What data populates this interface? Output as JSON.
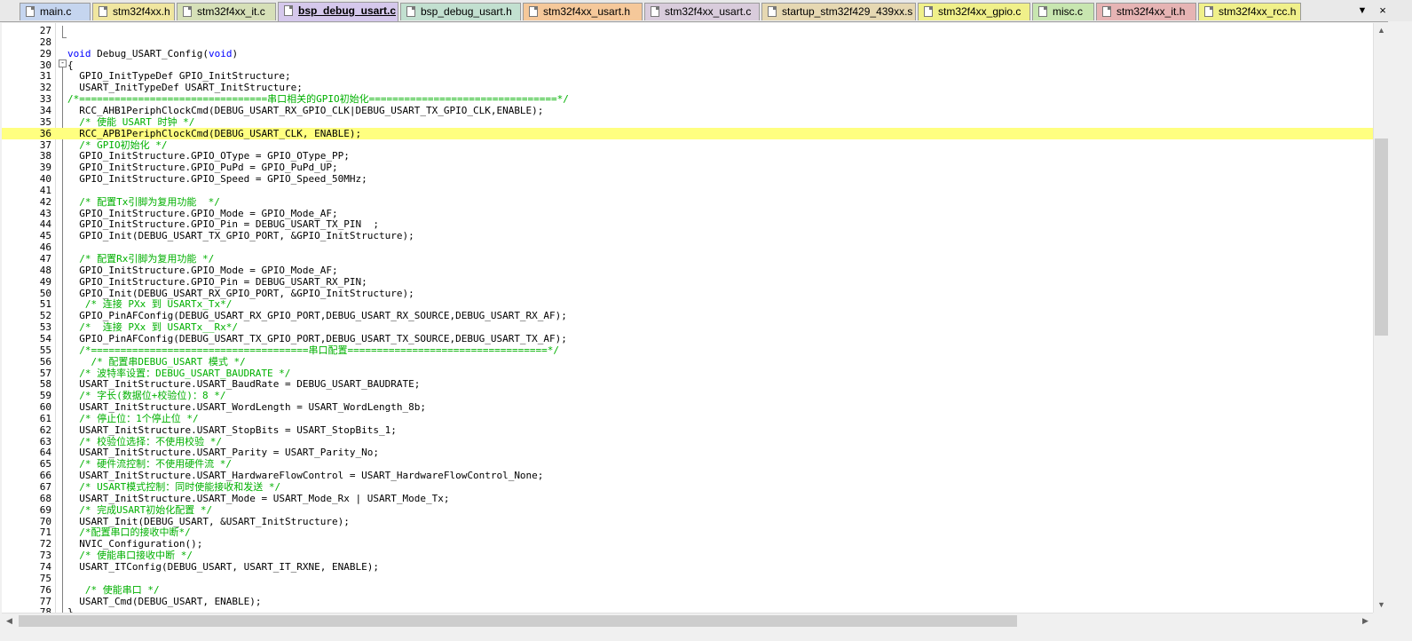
{
  "tabs": [
    {
      "label": "main.c",
      "color": "#c5d5ef",
      "active": false
    },
    {
      "label": "stm32f4xx.h",
      "color": "#f0e6a0",
      "active": false
    },
    {
      "label": "stm32f4xx_it.c",
      "color": "#d6e0b8",
      "active": false
    },
    {
      "label": "bsp_debug_usart.c",
      "color": "#d5c8ec",
      "active": true
    },
    {
      "label": "bsp_debug_usart.h",
      "color": "#c2e0d0",
      "active": false
    },
    {
      "label": "stm32f4xx_usart.h",
      "color": "#f5c89a",
      "active": false
    },
    {
      "label": "stm32f4xx_usart.c",
      "color": "#d9ccdc",
      "active": false
    },
    {
      "label": "startup_stm32f429_439xx.s",
      "color": "#e6d8b2",
      "active": false
    },
    {
      "label": "stm32f4xx_gpio.c",
      "color": "#f0f08a",
      "active": false
    },
    {
      "label": "misc.c",
      "color": "#c8e6b0",
      "active": false
    },
    {
      "label": "stm32f4xx_it.h",
      "color": "#e6b4b4",
      "active": false
    },
    {
      "label": "stm32f4xx_rcc.h",
      "color": "#f0f08a",
      "active": false
    }
  ],
  "tab_menu_icon": "dropdown-arrow-icon",
  "tab_close_icon": "close-icon",
  "tab_menu_glyph": "▼",
  "tab_close_glyph": "×",
  "current_line": 36,
  "fold_glyph": "-",
  "colors": {
    "comment": "#00b000",
    "keyword": "#0000ff",
    "current_line_bg": "#ffff80"
  },
  "code_lines": [
    {
      "n": "27",
      "text": "",
      "type": "code"
    },
    {
      "n": "28",
      "text": "",
      "type": "code"
    },
    {
      "n": "29",
      "text": "void Debug_USART_Config(void)",
      "type": "code"
    },
    {
      "n": "30",
      "text": "{",
      "type": "code"
    },
    {
      "n": "31",
      "text": "  GPIO_InitTypeDef GPIO_InitStructure;",
      "type": "code"
    },
    {
      "n": "32",
      "text": "  USART_InitTypeDef USART_InitStructure;",
      "type": "code"
    },
    {
      "n": "33",
      "text": "/*================================串口相关的GPIO初始化================================*/",
      "type": "comment"
    },
    {
      "n": "34",
      "text": "  RCC_AHB1PeriphClockCmd(DEBUG_USART_RX_GPIO_CLK|DEBUG_USART_TX_GPIO_CLK,ENABLE);",
      "type": "code"
    },
    {
      "n": "35",
      "text": "  /* 使能 USART 时钟 */",
      "type": "comment"
    },
    {
      "n": "36",
      "text": "  RCC_APB1PeriphClockCmd(DEBUG_USART_CLK, ENABLE);",
      "type": "code"
    },
    {
      "n": "37",
      "text": "  /* GPIO初始化 */",
      "type": "comment"
    },
    {
      "n": "38",
      "text": "  GPIO_InitStructure.GPIO_OType = GPIO_OType_PP;",
      "type": "code"
    },
    {
      "n": "39",
      "text": "  GPIO_InitStructure.GPIO_PuPd = GPIO_PuPd_UP;",
      "type": "code"
    },
    {
      "n": "40",
      "text": "  GPIO_InitStructure.GPIO_Speed = GPIO_Speed_50MHz;",
      "type": "code"
    },
    {
      "n": "41",
      "text": "",
      "type": "code"
    },
    {
      "n": "42",
      "text": "  /* 配置Tx引脚为复用功能  */",
      "type": "comment"
    },
    {
      "n": "43",
      "text": "  GPIO_InitStructure.GPIO_Mode = GPIO_Mode_AF;",
      "type": "code"
    },
    {
      "n": "44",
      "text": "  GPIO_InitStructure.GPIO_Pin = DEBUG_USART_TX_PIN  ;",
      "type": "code"
    },
    {
      "n": "45",
      "text": "  GPIO_Init(DEBUG_USART_TX_GPIO_PORT, &GPIO_InitStructure);",
      "type": "code"
    },
    {
      "n": "46",
      "text": "",
      "type": "code"
    },
    {
      "n": "47",
      "text": "  /* 配置Rx引脚为复用功能 */",
      "type": "comment"
    },
    {
      "n": "48",
      "text": "  GPIO_InitStructure.GPIO_Mode = GPIO_Mode_AF;",
      "type": "code"
    },
    {
      "n": "49",
      "text": "  GPIO_InitStructure.GPIO_Pin = DEBUG_USART_RX_PIN;",
      "type": "code"
    },
    {
      "n": "50",
      "text": "  GPIO_Init(DEBUG_USART_RX_GPIO_PORT, &GPIO_InitStructure);",
      "type": "code"
    },
    {
      "n": "51",
      "text": "   /* 连接 PXx 到 USARTx_Tx*/",
      "type": "comment"
    },
    {
      "n": "52",
      "text": "  GPIO_PinAFConfig(DEBUG_USART_RX_GPIO_PORT,DEBUG_USART_RX_SOURCE,DEBUG_USART_RX_AF);",
      "type": "code"
    },
    {
      "n": "53",
      "text": "  /*  连接 PXx 到 USARTx__Rx*/",
      "type": "comment"
    },
    {
      "n": "54",
      "text": "  GPIO_PinAFConfig(DEBUG_USART_TX_GPIO_PORT,DEBUG_USART_TX_SOURCE,DEBUG_USART_TX_AF);",
      "type": "code"
    },
    {
      "n": "55",
      "text": "  /*=====================================串口配置==================================*/",
      "type": "comment"
    },
    {
      "n": "56",
      "text": "    /* 配置串DEBUG_USART 模式 */",
      "type": "comment"
    },
    {
      "n": "57",
      "text": "  /* 波特率设置：DEBUG_USART_BAUDRATE */",
      "type": "comment"
    },
    {
      "n": "58",
      "text": "  USART_InitStructure.USART_BaudRate = DEBUG_USART_BAUDRATE;",
      "type": "code"
    },
    {
      "n": "59",
      "text": "  /* 字长(数据位+校验位)：8 */",
      "type": "comment"
    },
    {
      "n": "60",
      "text": "  USART_InitStructure.USART_WordLength = USART_WordLength_8b;",
      "type": "code"
    },
    {
      "n": "61",
      "text": "  /* 停止位：1个停止位 */",
      "type": "comment"
    },
    {
      "n": "62",
      "text": "  USART_InitStructure.USART_StopBits = USART_StopBits_1;",
      "type": "code"
    },
    {
      "n": "63",
      "text": "  /* 校验位选择：不使用校验 */",
      "type": "comment"
    },
    {
      "n": "64",
      "text": "  USART_InitStructure.USART_Parity = USART_Parity_No;",
      "type": "code"
    },
    {
      "n": "65",
      "text": "  /* 硬件流控制：不使用硬件流 */",
      "type": "comment"
    },
    {
      "n": "66",
      "text": "  USART_InitStructure.USART_HardwareFlowControl = USART_HardwareFlowControl_None;",
      "type": "code"
    },
    {
      "n": "67",
      "text": "  /* USART模式控制：同时使能接收和发送 */",
      "type": "comment"
    },
    {
      "n": "68",
      "text": "  USART_InitStructure.USART_Mode = USART_Mode_Rx | USART_Mode_Tx;",
      "type": "code"
    },
    {
      "n": "69",
      "text": "  /* 完成USART初始化配置 */",
      "type": "comment"
    },
    {
      "n": "70",
      "text": "  USART_Init(DEBUG_USART, &USART_InitStructure);",
      "type": "code"
    },
    {
      "n": "71",
      "text": "  /*配置串口的接收中断*/",
      "type": "comment"
    },
    {
      "n": "72",
      "text": "  NVIC_Configuration();",
      "type": "code"
    },
    {
      "n": "73",
      "text": "  /* 使能串口接收中断 */",
      "type": "comment"
    },
    {
      "n": "74",
      "text": "  USART_ITConfig(DEBUG_USART, USART_IT_RXNE, ENABLE);",
      "type": "code"
    },
    {
      "n": "75",
      "text": "",
      "type": "code"
    },
    {
      "n": "76",
      "text": "   /* 使能串口 */",
      "type": "comment"
    },
    {
      "n": "77",
      "text": "  USART_Cmd(DEBUG_USART, ENABLE);",
      "type": "code"
    },
    {
      "n": "78",
      "text": "}",
      "type": "code"
    }
  ],
  "scroll": {
    "up": "▲",
    "down": "▼",
    "left": "◀",
    "right": "▶"
  }
}
